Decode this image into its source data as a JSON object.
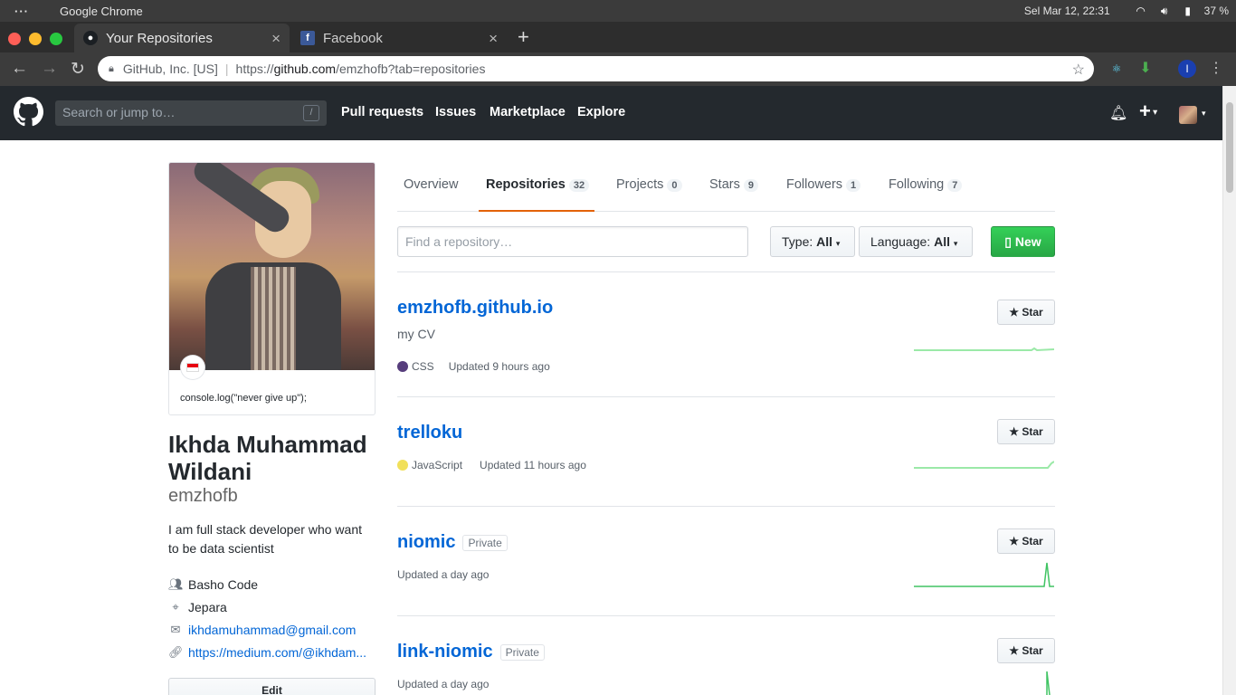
{
  "os": {
    "menu_dots": "···",
    "app_name": "Google Chrome",
    "clock": "Sel Mar 12, 22:31",
    "battery": "37 %"
  },
  "browser": {
    "tabs": [
      {
        "title": "Your Repositories",
        "active": true,
        "icon": "github-icon"
      },
      {
        "title": "Facebook",
        "active": false,
        "icon": "facebook-icon"
      }
    ],
    "new_tab": "+",
    "site_identity": "GitHub, Inc. [US]",
    "url_prefix": "https://",
    "url_domain": "github.com",
    "url_path": "/emzhofb?tab=repositories",
    "profile_initial": "I"
  },
  "header": {
    "search_placeholder": "Search or jump to…",
    "search_key": "/",
    "nav": [
      "Pull requests",
      "Issues",
      "Marketplace",
      "Explore"
    ]
  },
  "profile": {
    "status": "console.log(\"never give up\");",
    "full_name": "Ikhda Muhammad Wildani",
    "username": "emzhofb",
    "bio": "I am full stack developer who want to be data scientist",
    "company": "Basho Code",
    "location": "Jepara",
    "email": "ikhdamuhammad@gmail.com",
    "website": "https://medium.com/@ikhdam...",
    "edit_label": "Edit"
  },
  "profile_tabs": [
    {
      "label": "Overview",
      "count": null,
      "selected": false
    },
    {
      "label": "Repositories",
      "count": "32",
      "selected": true
    },
    {
      "label": "Projects",
      "count": "0",
      "selected": false
    },
    {
      "label": "Stars",
      "count": "9",
      "selected": false
    },
    {
      "label": "Followers",
      "count": "1",
      "selected": false
    },
    {
      "label": "Following",
      "count": "7",
      "selected": false
    }
  ],
  "filters": {
    "find_placeholder": "Find a repository…",
    "type_label": "Type:",
    "type_value": "All",
    "language_label": "Language:",
    "language_value": "All",
    "new_label": "New"
  },
  "repos": [
    {
      "name": "emzhofb.github.io",
      "private": false,
      "description": "my CV",
      "language": "CSS",
      "language_color": "#563d7c",
      "updated": "Updated 9 hours ago",
      "star_label": "Star"
    },
    {
      "name": "trelloku",
      "private": false,
      "description": "",
      "language": "JavaScript",
      "language_color": "#f1e05a",
      "updated": "Updated 11 hours ago",
      "star_label": "Star"
    },
    {
      "name": "niomic",
      "private": true,
      "description": "",
      "language": "",
      "language_color": "",
      "updated": "Updated a day ago",
      "star_label": "Star"
    },
    {
      "name": "link-niomic",
      "private": true,
      "description": "",
      "language": "",
      "language_color": "",
      "updated": "Updated a day ago",
      "star_label": "Star"
    }
  ],
  "private_label": "Private",
  "colors": {
    "link": "#0366d6",
    "header_bg": "#24292e",
    "accent_tab": "#e36209",
    "new_button": "#28a745"
  }
}
